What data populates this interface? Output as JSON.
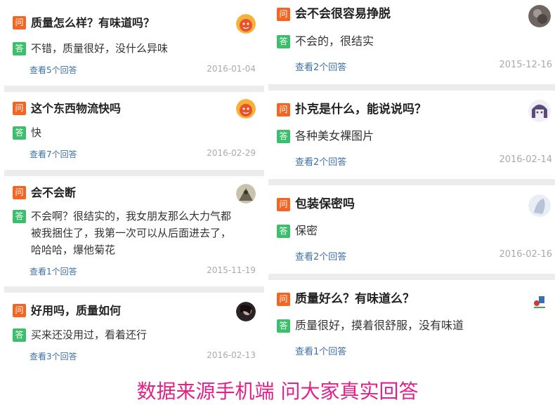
{
  "labels": {
    "question_tag": "问",
    "answer_tag": "答"
  },
  "left_column": [
    {
      "question": "质量怎么样？有味道吗？",
      "answer": "不错，质量很好，没什么异味",
      "more": "查看5个回答",
      "date": "2016-01-04",
      "avatar": "orange-cartoon-avatar"
    },
    {
      "question": "这个东西物流快吗",
      "answer": "快",
      "more": "查看7个回答",
      "date": "2016-02-29",
      "avatar": "orange-cartoon-avatar"
    },
    {
      "question": "会不会断",
      "answer": "不会啊？很结实的，我女朋友那么大力气都被我捆住了，我第一次可以从后面进去了，哈哈哈，爆他菊花",
      "more": "查看1个回答",
      "date": "2015-11-19",
      "avatar": "photo-avatar"
    },
    {
      "question": "好用吗，质量如何",
      "answer": "买来还没用过，看着还行",
      "more": "查看3个回答",
      "date": "2016-02-13",
      "avatar": "dark-photo-avatar"
    }
  ],
  "right_column": [
    {
      "question": "会不会很容易挣脱",
      "answer": "不会的，很结实",
      "more": "查看2个回答",
      "date": "2015-12-16",
      "avatar": "grey-photo-avatar"
    },
    {
      "question": "扑克是什么，能说说吗？",
      "answer": "各种美女裸图片",
      "more": "查看2个回答",
      "date": "2016-02-14",
      "avatar": "anime-avatar"
    },
    {
      "question": "包装保密吗",
      "answer": "保密",
      "more": "查看2个回答",
      "date": "2016-02-16",
      "avatar": "light-photo-avatar"
    },
    {
      "question": "质量好么？有味道么？",
      "answer": "质量很好，摸着很舒服，没有味道",
      "more": "查看1个回答",
      "date": "",
      "avatar": "small-icon-avatar"
    }
  ],
  "footer": "数据来源手机端 问大家真实回答"
}
